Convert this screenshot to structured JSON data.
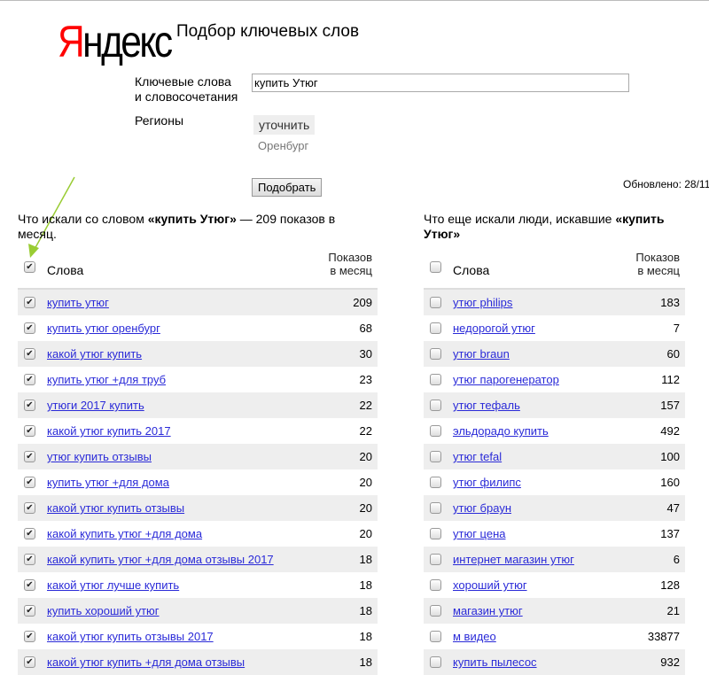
{
  "logo": {
    "first": "Я",
    "rest": "ндекс"
  },
  "title": "Подбор ключевых слов",
  "form": {
    "keywords_label_1": "Ключевые слова",
    "keywords_label_2": "и словосочетания",
    "keywords_value": "купить Утюг",
    "regions_label": "Регионы",
    "refine_button": "уточнить",
    "region": "Оренбург",
    "submit_button": "Подобрать",
    "updated": "Обновлено: 28/11"
  },
  "left": {
    "caption_pre": "Что искали со словом ",
    "caption_bold": "«купить Утюг»",
    "caption_post": " — 209 показов в месяц.",
    "col_words": "Слова",
    "col_shows_1": "Показов",
    "col_shows_2": "в месяц",
    "rows": [
      [
        "купить утюг",
        "209"
      ],
      [
        "купить утюг оренбург",
        "68"
      ],
      [
        "какой утюг купить",
        "30"
      ],
      [
        "купить утюг +для труб",
        "23"
      ],
      [
        "утюги 2017 купить",
        "22"
      ],
      [
        "какой утюг купить 2017",
        "22"
      ],
      [
        "утюг купить отзывы",
        "20"
      ],
      [
        "купить утюг +для дома",
        "20"
      ],
      [
        "какой утюг купить отзывы",
        "20"
      ],
      [
        "какой купить утюг +для дома",
        "20"
      ],
      [
        "какой купить утюг +для дома отзывы 2017",
        "18"
      ],
      [
        "какой утюг лучше купить",
        "18"
      ],
      [
        "купить хороший утюг",
        "18"
      ],
      [
        "какой утюг купить отзывы 2017",
        "18"
      ],
      [
        "какой утюг купить +для дома отзывы",
        "18"
      ]
    ]
  },
  "right": {
    "caption_pre": "Что еще искали люди, искавшие ",
    "caption_bold": "«купить Утюг»",
    "col_words": "Слова",
    "col_shows_1": "Показов",
    "col_shows_2": "в месяц",
    "rows": [
      [
        "утюг philips",
        "183"
      ],
      [
        "недорогой утюг",
        "7"
      ],
      [
        "утюг braun",
        "60"
      ],
      [
        "утюг парогенератор",
        "112"
      ],
      [
        "утюг тефаль",
        "157"
      ],
      [
        "эльдорадо купить",
        "492"
      ],
      [
        "утюг tefal",
        "100"
      ],
      [
        "утюг филипс",
        "160"
      ],
      [
        "утюг браун",
        "47"
      ],
      [
        "утюг цена",
        "137"
      ],
      [
        "интернет магазин утюг",
        "6"
      ],
      [
        "хороший утюг",
        "128"
      ],
      [
        "магазин утюг",
        "21"
      ],
      [
        "м видео",
        "33877"
      ],
      [
        "купить пылесос",
        "932"
      ]
    ]
  }
}
